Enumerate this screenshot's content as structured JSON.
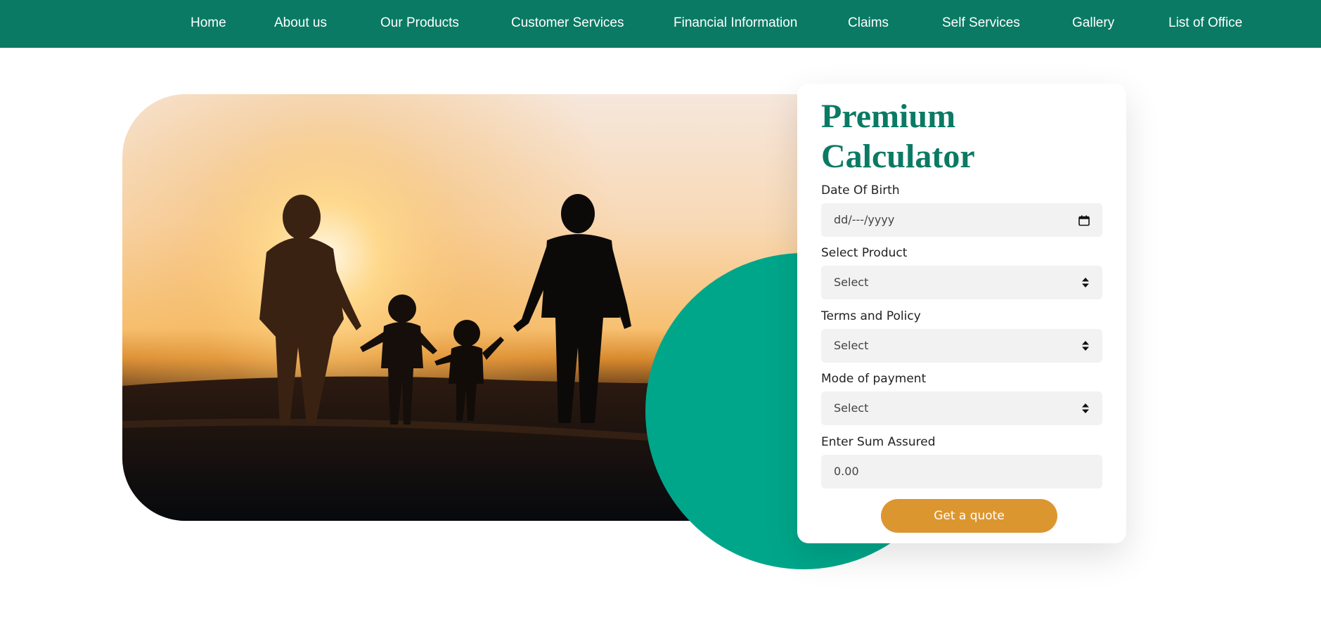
{
  "nav": {
    "items": [
      {
        "label": "Home"
      },
      {
        "label": "About us"
      },
      {
        "label": "Our Products"
      },
      {
        "label": "Customer Services"
      },
      {
        "label": "Financial Information"
      },
      {
        "label": "Claims"
      },
      {
        "label": "Self Services"
      },
      {
        "label": "Gallery"
      },
      {
        "label": "List of Office"
      }
    ]
  },
  "colors": {
    "nav_bg": "#0a7a64",
    "accent": "#00a68a",
    "title": "#0a7a64",
    "button": "#dc9630"
  },
  "calculator": {
    "title": "Premium Calculator",
    "dob": {
      "label": "Date Of Birth",
      "placeholder": "dd/---/yyyy",
      "icon": "calendar-icon"
    },
    "product": {
      "label": "Select Product",
      "value": "Select",
      "icon": "sort-arrows-icon"
    },
    "terms": {
      "label": "Terms and Policy",
      "value": "Select",
      "icon": "sort-arrows-icon"
    },
    "payment": {
      "label": "Mode of payment",
      "value": "Select",
      "icon": "sort-arrows-icon"
    },
    "sum": {
      "label": "Enter Sum Assured",
      "placeholder": "0.00"
    },
    "button_label": "Get a quote"
  }
}
